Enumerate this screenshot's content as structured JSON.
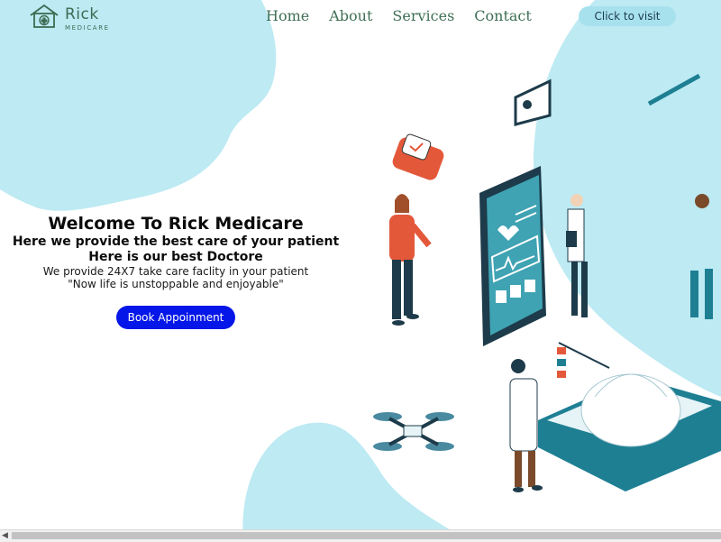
{
  "brand": {
    "name": "Rick",
    "tagline": "MEDICARE"
  },
  "nav": {
    "links": [
      {
        "label": "Home"
      },
      {
        "label": "About"
      },
      {
        "label": "Services"
      },
      {
        "label": "Contact"
      }
    ],
    "cta_label": "Click to visit"
  },
  "hero": {
    "title": "Welcome To Rick Medicare",
    "line1": "Here we provide the best care of your patient",
    "line2": "Here is our best Doctore",
    "line3": "We provide 24X7 take care faclity in your patient",
    "line4": "\"Now life is unstoppable and enjoyable\"",
    "button_label": "Book Appoinment"
  },
  "colors": {
    "blob": "#bdeaf3",
    "nav_text": "#3f6f55",
    "cta_bg": "#a7e1ee",
    "primary_button": "#0516e8",
    "teal": "#1e7f93",
    "orange": "#e4583a"
  },
  "icons": [
    "home-cross-logo-icon",
    "scroll-left-arrow-icon"
  ]
}
